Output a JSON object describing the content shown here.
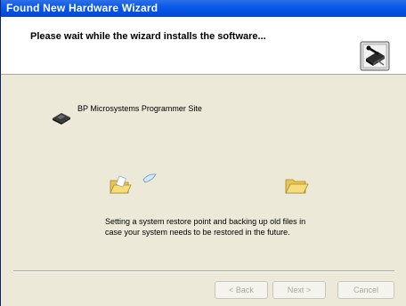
{
  "window": {
    "title": "Found New Hardware Wizard"
  },
  "header": {
    "title": "Please wait while the wizard installs the software...",
    "icon": "hardware-wizard-icon"
  },
  "device": {
    "name": "BP Microsystems Programmer Site",
    "icon": "hardware-device-icon"
  },
  "progress": {
    "status_line1": "Setting a system restore point and backing up old files in",
    "status_line2": "case your system needs to be restored in the future.",
    "source_icon": "folder-icon",
    "destination_icon": "folder-icon"
  },
  "buttons": {
    "back": "< Back",
    "next": "Next >",
    "cancel": "Cancel"
  },
  "colors": {
    "titlebar": "#0a5ae8",
    "dialog_bg": "#ece9d8",
    "disabled_text": "#aca899"
  }
}
